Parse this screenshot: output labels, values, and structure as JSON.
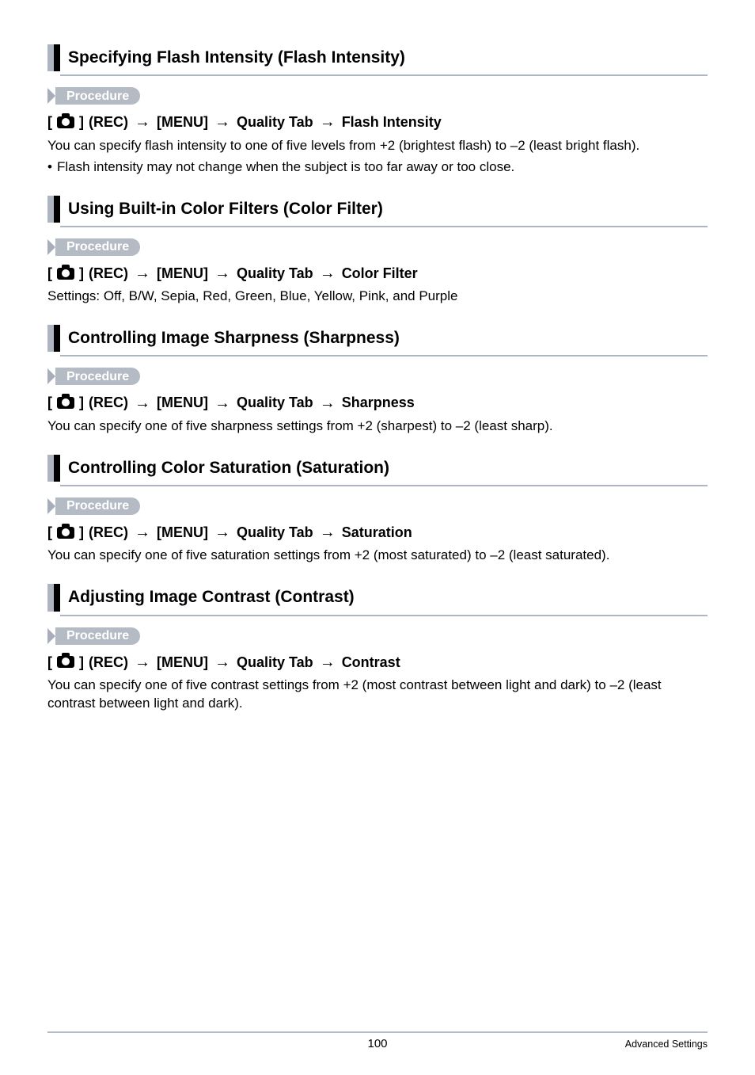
{
  "procedure_label": "Procedure",
  "rec_label": "(REC)",
  "menu_label": "[MENU]",
  "qtab_label": "Quality Tab",
  "sections": {
    "flash": {
      "title": "Specifying Flash Intensity (Flash Intensity)",
      "target": "Flash Intensity",
      "body": "You can specify flash intensity to one of five levels from +2 (brightest flash) to –2 (least bright flash).",
      "bullet": "Flash intensity may not change when the subject is too far away or too close."
    },
    "colorfilter": {
      "title": "Using Built-in Color Filters (Color Filter)",
      "target": "Color Filter",
      "body": "Settings: Off, B/W, Sepia, Red, Green, Blue, Yellow, Pink, and Purple"
    },
    "sharpness": {
      "title": "Controlling Image Sharpness (Sharpness)",
      "target": "Sharpness",
      "body": "You can specify one of five sharpness settings from +2 (sharpest) to –2 (least sharp)."
    },
    "saturation": {
      "title": "Controlling Color Saturation (Saturation)",
      "target": "Saturation",
      "body": "You can specify one of five saturation settings from +2 (most saturated) to –2 (least saturated)."
    },
    "contrast": {
      "title": "Adjusting Image Contrast (Contrast)",
      "target": "Contrast",
      "body": "You can specify one of five contrast settings from +2 (most contrast between light and dark) to –2 (least contrast between light and dark)."
    }
  },
  "footer": {
    "page_number": "100",
    "section_label": "Advanced Settings"
  }
}
